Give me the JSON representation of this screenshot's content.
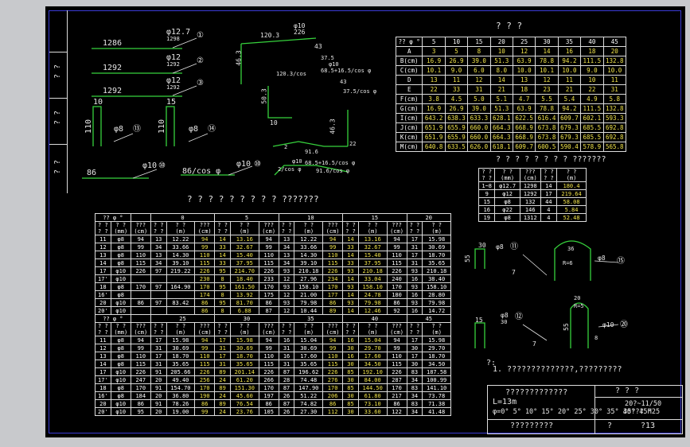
{
  "side_labels": [
    "? ?",
    "? ?",
    "? ?"
  ],
  "top_table": {
    "title": "? ? ?",
    "header": [
      "?? φ °",
      "5",
      "10",
      "15",
      "20",
      "25",
      "30",
      "35",
      "40",
      "45"
    ],
    "rows": [
      [
        "A",
        "3",
        "5",
        "8",
        "10",
        "12",
        "14",
        "16",
        "18",
        "20"
      ],
      [
        "B(cm)",
        "16.9",
        "26.9",
        "39.0",
        "51.3",
        "63.9",
        "78.8",
        "94.2",
        "111.5",
        "132.8"
      ],
      [
        "C(cm)",
        "10.1",
        "9.0",
        "6.0",
        "8.0",
        "10.0",
        "10.1",
        "10.0",
        "9.0",
        "10.0"
      ],
      [
        "D",
        "13",
        "11",
        "12",
        "14",
        "13",
        "12",
        "11",
        "10",
        "11"
      ],
      [
        "E",
        "22",
        "33",
        "31",
        "21",
        "18",
        "23",
        "21",
        "22",
        "31"
      ],
      [
        "F(cm)",
        "3.8",
        "4.5",
        "5.0",
        "5.1",
        "4.7",
        "5.5",
        "5.4",
        "4.9",
        "5.8"
      ],
      [
        "G(cm)",
        "16.9",
        "26.9",
        "39.0",
        "51.3",
        "63.9",
        "78.8",
        "94.2",
        "111.5",
        "132.8"
      ],
      [
        "I(cm)",
        "643.2",
        "638.3",
        "633.3",
        "628.1",
        "622.5",
        "616.4",
        "609.7",
        "602.1",
        "593.3"
      ],
      [
        "J(cm)",
        "651.9",
        "655.9",
        "660.0",
        "664.3",
        "668.9",
        "673.8",
        "679.3",
        "685.5",
        "692.8"
      ],
      [
        "K(cm)",
        "651.9",
        "655.9",
        "660.0",
        "664.3",
        "668.9",
        "673.8",
        "679.3",
        "685.5",
        "692.8"
      ],
      [
        "M(cm)",
        "640.8",
        "633.5",
        "626.0",
        "618.1",
        "609.7",
        "600.5",
        "590.4",
        "578.9",
        "565.8"
      ]
    ]
  },
  "small_table": {
    "title": "? ? ? ? ? ? ? ? ???????",
    "header": [
      "? ?\n? ?",
      "? ?\n(mm)",
      "???\n(cm)",
      "? ?\n? ?",
      "? ?\n(m)"
    ],
    "rows": [
      [
        "1~8",
        "φ12.7",
        "1298",
        "14",
        "180.4"
      ],
      [
        "9",
        "φ12",
        "1292",
        "17",
        "219.64"
      ],
      [
        "15",
        "φ8",
        "132",
        "44",
        "58.08"
      ],
      [
        "16",
        "φ22",
        "146",
        "4",
        "5.84"
      ],
      [
        "19",
        "φ8",
        "1312",
        "4",
        "52.48"
      ]
    ]
  },
  "big_table": {
    "title": "? ? ? ? ? ? ? ? ? ???????",
    "top_header": {
      "corner": "?? φ °",
      "groups": [
        "0",
        "5",
        "10",
        "15",
        "20"
      ]
    },
    "sub_header": [
      "? ?\n? ?",
      "? ?\n(mm)",
      "???\n(cm)",
      "? ?\n? ?",
      "? ?\n(m)",
      "???\n(cm)",
      "? ?\n? ?",
      "? ?\n(m)",
      "???\n(cm)",
      "? ?\n? ?",
      "? ?\n(m)",
      "???\n(cm)",
      "? ?\n? ?",
      "? ?\n(m)",
      "???\n(cm)",
      "? ?\n? ?",
      "? ?\n(m)"
    ],
    "rows_a": [
      [
        "11",
        "φ8",
        "94",
        "13",
        "12.22",
        "94",
        "14",
        "13.16",
        "94",
        "13",
        "12.22",
        "94",
        "14",
        "13.16",
        "94",
        "17",
        "15.98"
      ],
      [
        "12",
        "φ8",
        "99",
        "34",
        "33.66",
        "99",
        "33",
        "32.67",
        "99",
        "34",
        "33.66",
        "99",
        "33",
        "32.67",
        "99",
        "31",
        "30.69"
      ],
      [
        "13",
        "φ8",
        "110",
        "13",
        "14.30",
        "110",
        "14",
        "15.40",
        "110",
        "13",
        "14.30",
        "110",
        "14",
        "15.40",
        "110",
        "17",
        "18.70"
      ],
      [
        "14",
        "φ8",
        "115",
        "34",
        "39.10",
        "115",
        "33",
        "37.95",
        "115",
        "34",
        "39.10",
        "115",
        "33",
        "37.95",
        "115",
        "31",
        "35.65"
      ],
      [
        "17",
        "φ10",
        "226",
        "97",
        "219.22",
        "226",
        "95",
        "214.70",
        "226",
        "93",
        "210.18",
        "226",
        "93",
        "210.18",
        "226",
        "93",
        "210.18"
      ],
      [
        "17'",
        "φ10",
        "",
        "",
        "",
        "230",
        "8",
        "18.40",
        "233",
        "12",
        "27.96",
        "234",
        "14",
        "33.04",
        "240",
        "16",
        "38.40"
      ],
      [
        "18",
        "φ8",
        "170",
        "97",
        "164.90",
        "170",
        "95",
        "161.50",
        "170",
        "93",
        "158.10",
        "170",
        "93",
        "158.10",
        "170",
        "93",
        "158.10"
      ],
      [
        "16'",
        "φ8",
        "",
        "",
        "",
        "174",
        "8",
        "13.92",
        "175",
        "12",
        "21.00",
        "177",
        "14",
        "24.78",
        "180",
        "16",
        "28.80"
      ],
      [
        "20",
        "φ10",
        "86",
        "97",
        "83.42",
        "86",
        "95",
        "81.70",
        "86",
        "93",
        "79.98",
        "86",
        "93",
        "79.98",
        "86",
        "93",
        "79.98"
      ],
      [
        "20'",
        "φ10",
        "",
        "",
        "",
        "86",
        "8",
        "6.88",
        "87",
        "12",
        "10.44",
        "89",
        "14",
        "12.46",
        "92",
        "16",
        "14.72"
      ]
    ],
    "top_header_b": {
      "corner": "?? φ °",
      "groups": [
        "25",
        "30",
        "35",
        "40",
        "45"
      ]
    },
    "rows_b": [
      [
        "11",
        "φ8",
        "94",
        "17",
        "15.98",
        "94",
        "17",
        "15.98",
        "94",
        "16",
        "15.04",
        "94",
        "16",
        "15.04",
        "94",
        "17",
        "15.98"
      ],
      [
        "12",
        "φ8",
        "99",
        "31",
        "30.69",
        "99",
        "31",
        "30.69",
        "99",
        "31",
        "30.69",
        "99",
        "30",
        "29.70",
        "99",
        "30",
        "29.70"
      ],
      [
        "13",
        "φ8",
        "110",
        "17",
        "18.70",
        "110",
        "17",
        "18.70",
        "110",
        "16",
        "17.60",
        "110",
        "16",
        "17.60",
        "110",
        "17",
        "18.70"
      ],
      [
        "14",
        "φ8",
        "115",
        "31",
        "35.65",
        "115",
        "31",
        "35.65",
        "115",
        "31",
        "35.65",
        "115",
        "30",
        "34.50",
        "115",
        "30",
        "34.50"
      ],
      [
        "17",
        "φ10",
        "226",
        "91",
        "205.66",
        "226",
        "89",
        "201.14",
        "226",
        "87",
        "196.62",
        "226",
        "85",
        "192.10",
        "226",
        "83",
        "187.58"
      ],
      [
        "17'",
        "φ10",
        "247",
        "20",
        "49.40",
        "256",
        "24",
        "61.20",
        "266",
        "28",
        "74.48",
        "276",
        "30",
        "84.00",
        "287",
        "34",
        "100.99"
      ],
      [
        "18",
        "φ8",
        "170",
        "91",
        "154.70",
        "170",
        "89",
        "151.30",
        "170",
        "87",
        "147.90",
        "170",
        "85",
        "144.50",
        "170",
        "83",
        "141.10"
      ],
      [
        "16'",
        "φ8",
        "184",
        "20",
        "36.80",
        "190",
        "24",
        "45.60",
        "197",
        "26",
        "51.22",
        "206",
        "30",
        "61.80",
        "217",
        "34",
        "73.78"
      ],
      [
        "20",
        "φ10",
        "86",
        "91",
        "78.26",
        "86",
        "89",
        "76.54",
        "86",
        "87",
        "74.82",
        "86",
        "85",
        "73.10",
        "86",
        "83",
        "71.38"
      ],
      [
        "20'",
        "φ10",
        "95",
        "20",
        "19.00",
        "99",
        "24",
        "23.76",
        "105",
        "26",
        "27.30",
        "112",
        "30",
        "33.60",
        "122",
        "34",
        "41.48"
      ]
    ]
  },
  "dims": {
    "bar_top1": "1286",
    "bar_top2": "1292",
    "bar_top3": "1292",
    "bar_a_label": "φ12.7",
    "bar_a_sub": "1298",
    "bar_b_label": "φ12",
    "bar_b_sub": "1292",
    "bar_c_label": "φ12",
    "bar_c_sub": "1292",
    "n1": "①",
    "n2": "②",
    "n3": "③",
    "n10": "⑩",
    "n13": "⑬",
    "n14": "⑭",
    "n15": "⑮",
    "hook_l": "10",
    "hook_r": "15",
    "hook_d1": "110",
    "hook_d2": "110",
    "hook_a": "φ8",
    "hook_b": "φ8",
    "bot_86": "86",
    "bot_86cos": "86/cos φ",
    "bot_phi10": "φ10",
    "bot_phi10b": "φ10",
    "frame_200": "120.3",
    "frame_226": "226",
    "frame_phi10": "φ10",
    "frame_463": "46.3",
    "frame_43": "43",
    "frame_375": "37.5",
    "frame_6851": "68.5+16.5/cos φ",
    "frame_503": "50.3",
    "frame_120cos": "120.3/cos",
    "frame_phi10b": "φ10",
    "frame_43b": "43",
    "frame_375cos": "37.5/cos φ",
    "frame_2": "2",
    "frame_916": "91.6",
    "frame_10": "10",
    "frame_22": "22",
    "frame_2cos": "2/cos φ",
    "frame_686": "68.5+16.5/cos φ",
    "frame_916cos": "91.6/cos φ",
    "frame_463b": "46.3",
    "frame_phi10c": "φ10",
    "r_55": "55",
    "r_30": "30",
    "r_phi8": "φ8",
    "r_n11": "⑪",
    "r_r6": "R=6",
    "r_phi8b": "φ8",
    "r_n15": "⑮",
    "r_phi8c": "φ8",
    "r_n12": "⑫",
    "r_8": "8",
    "r_15": "15",
    "r_20": "20",
    "r_r5": "R=5",
    "r_55b": "55",
    "r_phi10": "φ10",
    "r_n20": "⑳",
    "r_7": "7",
    "r_7b": "7",
    "r_30b": "30",
    "r_36": "36"
  },
  "notes": {
    "title": "?:",
    "line1": "1. ??????????????,?????????"
  },
  "title_block": {
    "top_left": "?????????????",
    "line1": "L=13m",
    "line2": "φ=0° 5° 10° 15° 20° 25° 30° 35° 40° 45°",
    "right_top": "? ? ?",
    "right_mid1": "20?~11/50",
    "right_mid2": "35??? H25",
    "bottom_left": "?????????",
    "bottom_right1": "?",
    "bottom_right2": "?13"
  }
}
